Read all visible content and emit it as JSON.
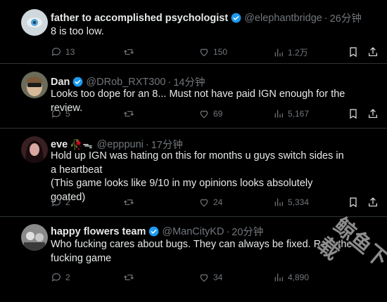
{
  "tweets": [
    {
      "name": "father to accomplished psychologist",
      "handle": "@elephantbridge",
      "time": "26分钟",
      "text": "8 is too low.",
      "replies": "13",
      "likes": "150",
      "views": "1.2万",
      "avatar_colors": [
        "#cfd8dc",
        "#4fa3d8"
      ]
    },
    {
      "name": "Dan",
      "handle": "@DRob_RXT300",
      "time": "14分钟",
      "text": "Looks too dope for an 8... Must not have paid IGN enough for the review.",
      "replies": "5",
      "likes": "69",
      "views": "5,167",
      "avatar_colors": [
        "#6b6b5a",
        "#d7b899"
      ]
    },
    {
      "name": "eve",
      "name_emoji": "🥀ᯓ",
      "handle": "@epppuni",
      "time": "17分钟",
      "text": "Hold up IGN was hating on this for months u guys switch sides in a heartbeat\n(This game looks like 9/10 in my opinions looks absolutely goated)",
      "replies": "2",
      "likes": "24",
      "views": "5,334",
      "avatar_colors": [
        "#3a1f22",
        "#d8a7a0"
      ]
    },
    {
      "name": "happy flowers team",
      "handle": "@ManCityKD",
      "time": "20分钟",
      "text": "Who fucking cares about bugs. They can always be fixed. Rate the fucking game",
      "replies": "2",
      "likes": "34",
      "views": "4,890",
      "avatar_colors": [
        "#8a8a8a",
        "#e0e0e0"
      ]
    }
  ],
  "watermark": "鲸鱼下载",
  "colors": {
    "background": "#000000",
    "text": "#e7e9ea",
    "muted": "#71767b",
    "verified": "#1d9bf0",
    "divider": "#2f3336"
  }
}
